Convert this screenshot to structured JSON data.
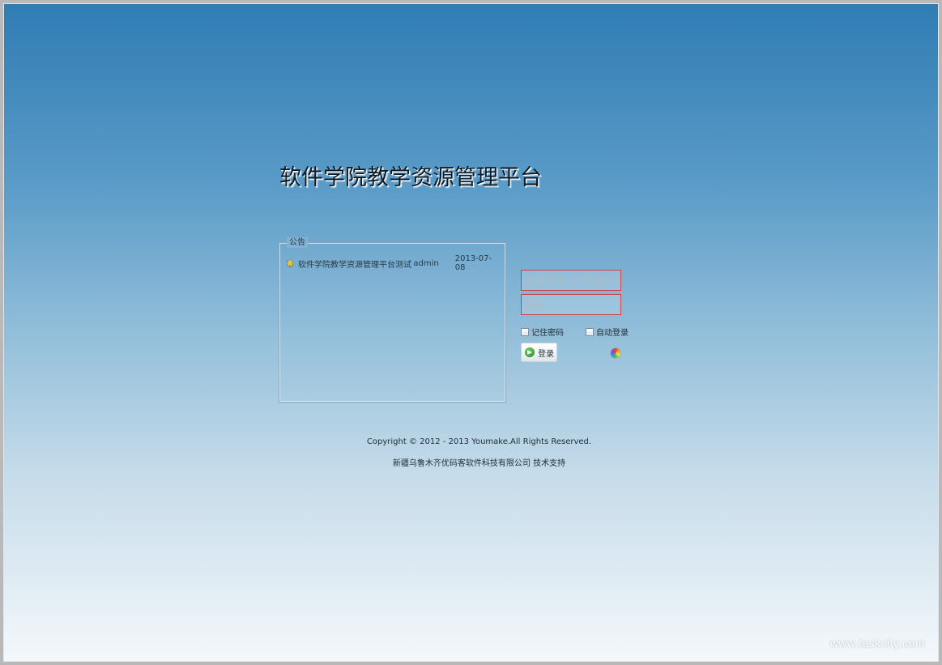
{
  "app_title": "软件学院教学资源管理平台",
  "notice": {
    "legend": "公告",
    "items": [
      {
        "title": "软件学院教学资源管理平台测试运行",
        "author": "admin",
        "date": "2013-07-08"
      }
    ]
  },
  "login": {
    "username_placeholder": "支持学号/工号/用户名",
    "password_placeholder": "密码",
    "remember_label": "记住密码",
    "autologin_label": "自动登录",
    "login_button": "登录"
  },
  "footer": {
    "copyright": "Copyright © 2012 - 2013 Youmake.All Rights Reserved.",
    "support": "新疆乌鲁木齐优码客软件科技有限公司 技术支持"
  },
  "watermark": "www.taskcity.com",
  "colors": {
    "accent_border": "#d34040",
    "bg_top": "#2f7cb4",
    "bg_bottom": "#f4f8fb"
  },
  "icons": {
    "notice_item": "notice-bell-icon",
    "login": "arrow-right-circle-icon",
    "theme": "color-wheel-icon"
  }
}
